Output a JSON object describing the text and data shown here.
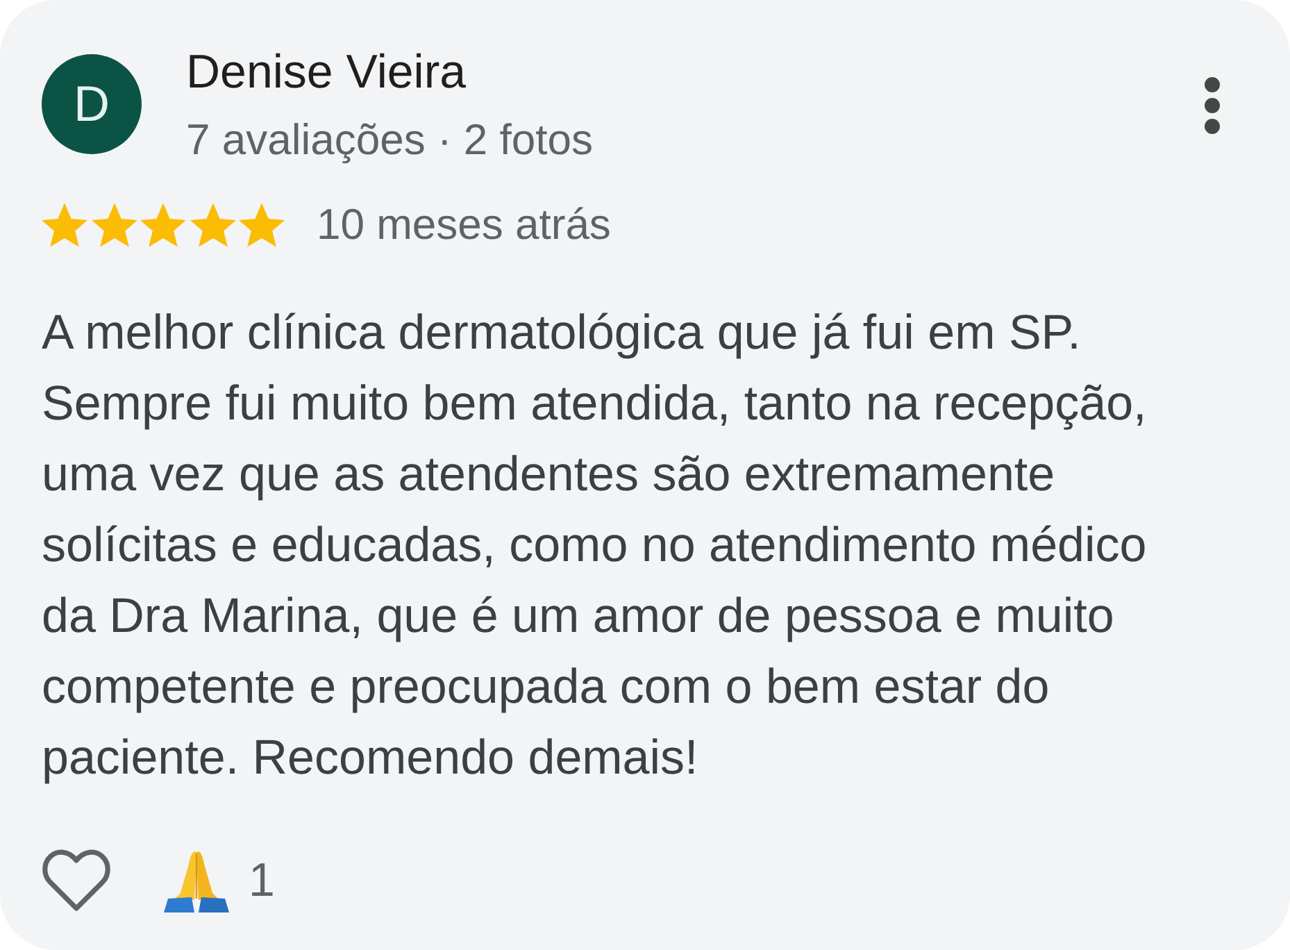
{
  "review": {
    "avatar_initial": "D",
    "author": "Denise Vieira",
    "author_stats": "7 avaliações · 2 fotos",
    "stars": 5,
    "time": "10 meses atrás",
    "text": "A melhor clínica dermatológica que já fui em SP. Sempre fui muito bem atendida, tanto na recepção, uma vez que as atendentes são extremamente solícitas e educadas, como no atendimento médico da Dra Marina, que é um amor de pessoa e muito competente e preocupada com o bem estar do paciente. Recomendo demais!",
    "reaction_count": "1"
  }
}
